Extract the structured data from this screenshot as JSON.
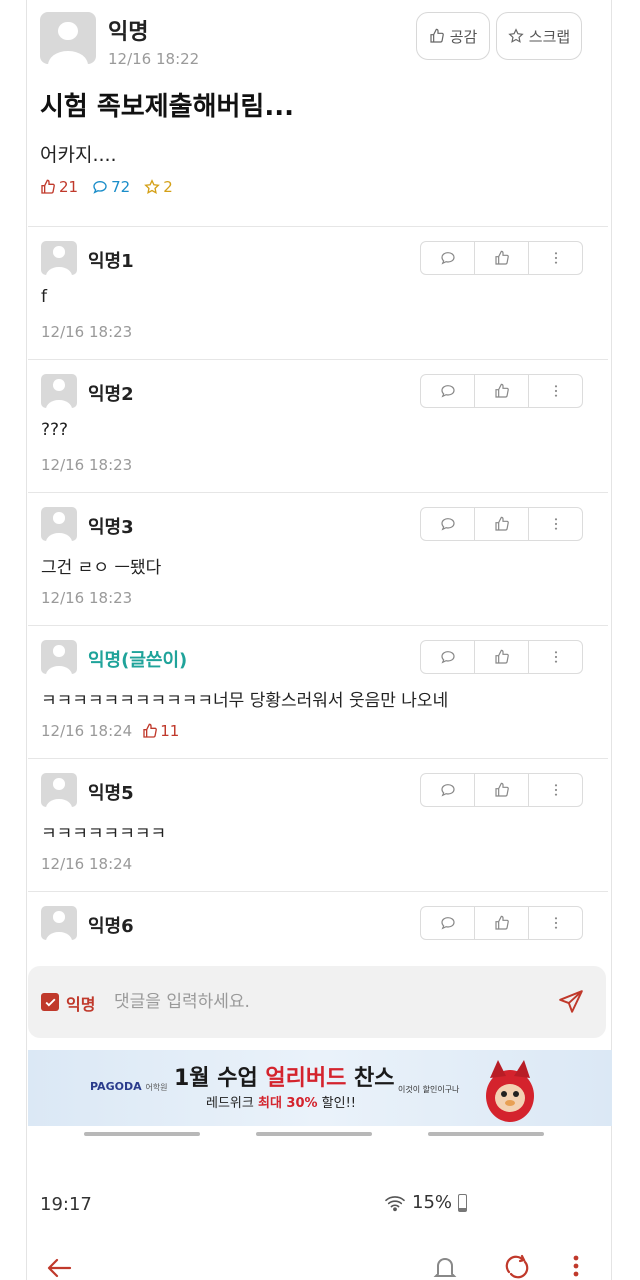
{
  "post": {
    "author": "익명",
    "time": "12/16 18:22",
    "like_button": "공감",
    "scrap_button": "스크랩",
    "title": "시험 족보제출해버림...",
    "body": "어카지....",
    "stats": {
      "likes": "21",
      "comments": "72",
      "scraps": "2"
    }
  },
  "comments": [
    {
      "author": "익명1",
      "body": "f",
      "time": "12/16 18:23",
      "votes": ""
    },
    {
      "author": "익명2",
      "body": "???",
      "time": "12/16 18:23",
      "votes": ""
    },
    {
      "author": "익명3",
      "body": "그건 ㄹㅇ ㅡ됐다",
      "time": "12/16 18:23",
      "votes": ""
    },
    {
      "author": "익명(글쓴이)",
      "body": "ㅋㅋㅋㅋㅋㅋㅋㅋㅋㅋㅋ너무 당황스러워서 웃음만 나오네",
      "time": "12/16 18:24",
      "votes": "11"
    },
    {
      "author": "익명5",
      "body": "ㅋㅋㅋㅋㅋㅋㅋㅋ",
      "time": "12/16 18:24",
      "votes": ""
    },
    {
      "author": "익명6",
      "body": "",
      "time": "",
      "votes": ""
    }
  ],
  "comment_input": {
    "anon_label": "익명",
    "placeholder": "댓글을 입력하세요."
  },
  "ad": {
    "logo": "PAGODA",
    "logo_sub": "어학원",
    "headline_pre": "1월 수업 ",
    "headline_highlight": "얼리버드",
    "headline_post": " 찬스",
    "sub_pre": "레드위크 ",
    "sub_bold": "최대 30%",
    "sub_post": " 할인!!",
    "side_text": "이것이 할인이구나"
  },
  "status_bar": {
    "time": "19:17",
    "battery": "15%"
  },
  "colors": {
    "accent_red": "#c0392b",
    "op_teal": "#1fa39a",
    "comment_blue": "#1a8dc9",
    "scrap_gold": "#d4a017"
  },
  "icons": {
    "like": "thumbs-up-icon",
    "comment": "speech-bubble-icon",
    "scrap": "star-icon",
    "more": "more-vertical-icon",
    "send": "send-icon",
    "back": "back-arrow-icon",
    "bell": "bell-icon",
    "refresh": "refresh-icon",
    "wifi": "wifi-icon"
  }
}
